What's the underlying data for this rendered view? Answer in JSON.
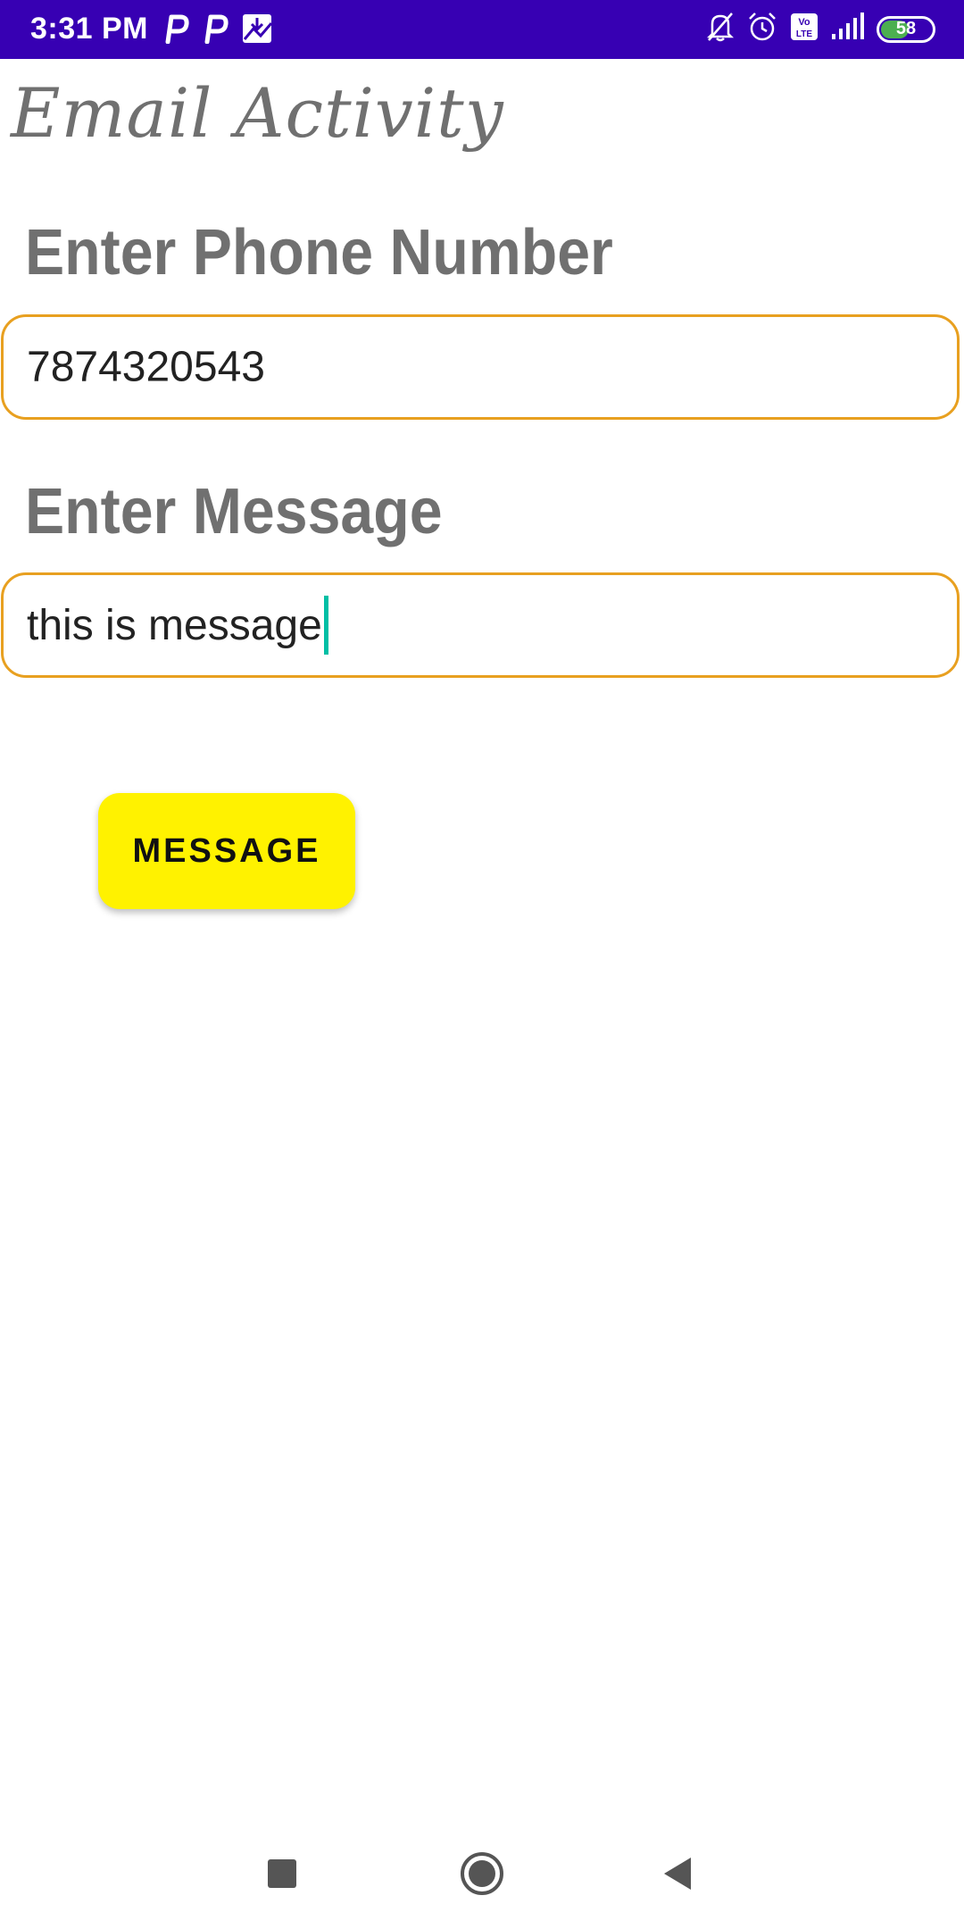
{
  "status_bar": {
    "time": "3:31 PM",
    "battery_level": "58",
    "icons_left": [
      "p-notification-icon",
      "p-notification-icon",
      "gallery-download-icon"
    ],
    "icons_right": [
      "bell-muted-icon",
      "alarm-icon",
      "volte-icon",
      "signal-icon",
      "battery-icon"
    ],
    "background_color": "#3700b3"
  },
  "app": {
    "title": "Email Activity"
  },
  "form": {
    "phone_label": "Enter Phone Number",
    "phone_value": "7874320543",
    "message_label": "Enter Message",
    "message_value": "this is message",
    "input_border_color": "#e8a020",
    "cursor_color": "#00bfa5"
  },
  "actions": {
    "message_button_label": "MESSAGE",
    "message_button_color": "#fff200"
  },
  "nav": {
    "recents": "recents-icon",
    "home": "home-icon",
    "back": "back-icon"
  }
}
